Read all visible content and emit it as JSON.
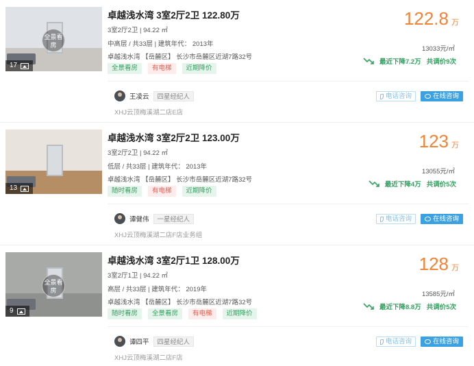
{
  "listings": [
    {
      "title": "卓越浅水湾 3室2厅2卫 122.80万",
      "layout_area": "3室2厅2卫 | 94.22 ㎡",
      "floor_year": "中高层 / 共33层 | 建筑年代： 2013年",
      "address": "卓越浅水湾 【岳麓区】 长沙市岳麓区近湖7路32号",
      "tags": [
        {
          "label": "全景看房",
          "color": "green"
        },
        {
          "label": "有电梯",
          "color": "red"
        },
        {
          "label": "近期降价",
          "color": "green"
        }
      ],
      "price": "122.8",
      "price_unit": "万",
      "unit_price": "13033元/㎡",
      "drop_text": "最近下降7.2万",
      "drop_count": "共调价9次",
      "photo_count": "17",
      "vr_label": "全景看房",
      "agent_name": "王凌云",
      "agent_title": "四星经纪人",
      "store": "XHJ云顶梅溪湖二店E店",
      "call_label": "电话咨询",
      "chat_label": "在线咨询",
      "wall_color": "#dfe3e7",
      "floor_color": "#c9c6c1"
    },
    {
      "title": "卓越浅水湾 3室2厅2卫 123.00万",
      "layout_area": "3室2厅2卫 | 94.22 ㎡",
      "floor_year": "低层 / 共33层 | 建筑年代： 2013年",
      "address": "卓越浅水湾 【岳麓区】 长沙市岳麓区近湖7路32号",
      "tags": [
        {
          "label": "随时看房",
          "color": "green"
        },
        {
          "label": "有电梯",
          "color": "red"
        },
        {
          "label": "近期降价",
          "color": "green"
        }
      ],
      "price": "123",
      "price_unit": "万",
      "unit_price": "13055元/㎡",
      "drop_text": "最近下降4万",
      "drop_count": "共调价5次",
      "photo_count": "13",
      "vr_label": "",
      "agent_name": "谭健伟",
      "agent_title": "一星经纪人",
      "store": "XHJ云顶梅溪湖二店F店业务组",
      "call_label": "电话咨询",
      "chat_label": "在线咨询",
      "wall_color": "#e8e4dd",
      "floor_color": "#b58e66"
    },
    {
      "title": "卓越浅水湾 3室2厅1卫 128.00万",
      "layout_area": "3室2厅1卫 | 94.22 ㎡",
      "floor_year": "高层 / 共33层 | 建筑年代： 2019年",
      "address": "卓越浅水湾 【岳麓区】 长沙市岳麓区近湖7路32号",
      "tags": [
        {
          "label": "随时看房",
          "color": "green"
        },
        {
          "label": "全景看房",
          "color": "green"
        },
        {
          "label": "有电梯",
          "color": "red"
        },
        {
          "label": "近期降价",
          "color": "green"
        }
      ],
      "price": "128",
      "price_unit": "万",
      "unit_price": "13585元/㎡",
      "drop_text": "最近下降8.8万",
      "drop_count": "共调价5次",
      "photo_count": "9",
      "vr_label": "全景看房",
      "agent_name": "谭四平",
      "agent_title": "四星经纪人",
      "store": "XHJ云顶梅溪湖二店F店",
      "call_label": "电话咨询",
      "chat_label": "在线咨询",
      "wall_color": "#a8aaa8",
      "floor_color": "#8f918f"
    }
  ],
  "colors": {
    "price": "#f18336",
    "green": "#33a05f",
    "chat_button": "#3aa2e3"
  },
  "icons": [
    "image-icon",
    "trend-down-icon",
    "phone-icon",
    "chat-icon",
    "vr-badge"
  ]
}
